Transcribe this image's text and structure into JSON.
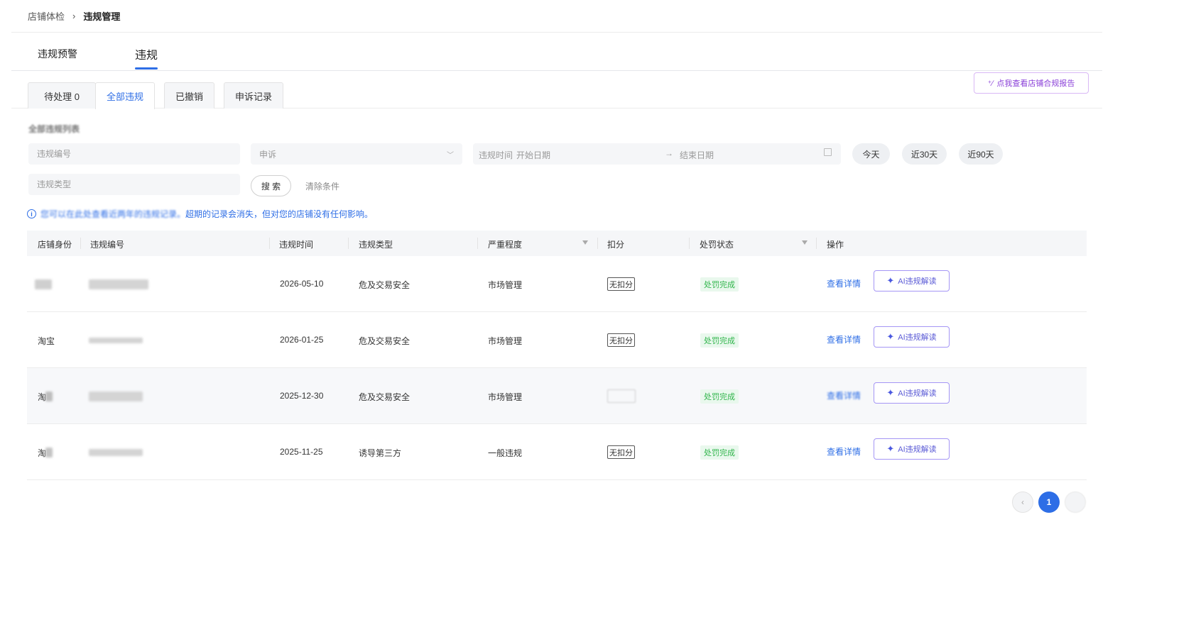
{
  "breadcrumb": {
    "parent": "店铺体检",
    "separator": "›",
    "current": "违规管理"
  },
  "main_tabs": [
    {
      "label": "违规预警",
      "active": false
    },
    {
      "label": "违规",
      "active": true
    }
  ],
  "sub_tabs": [
    {
      "label": "待处理 0",
      "active": false
    },
    {
      "label": "全部违规",
      "active": true
    },
    {
      "label": "已撤销",
      "active": false
    },
    {
      "label": "申诉记录",
      "active": false
    }
  ],
  "report_button": {
    "label": "点我查看店铺合规报告"
  },
  "section_title": "全部违规列表",
  "filters": {
    "violation_no_placeholder": "违规编号",
    "appeal_select_placeholder": "申诉",
    "violation_type_placeholder": "违规类型",
    "date_label": "违规时间",
    "start_date_placeholder": "开始日期",
    "range_arrow": "→",
    "end_date_placeholder": "结束日期",
    "quick": [
      "今天",
      "近30天",
      "近90天"
    ],
    "search_label": "搜 索",
    "clear_label": "清除条件"
  },
  "notice": {
    "text_blurred": "您可以在此处查看近两年的违规记录。",
    "text_visible": "超期的记录会消失，但对您的店铺没有任何影响。"
  },
  "table": {
    "headers": [
      "店铺身份",
      "违规编号",
      "违规时间",
      "违规类型",
      "严重程度",
      "扣分",
      "处罚状态",
      "操作"
    ],
    "rows": [
      {
        "shop": "",
        "date": "2026-05-10",
        "type": "危及交易安全",
        "severity": "市场管理",
        "score": "无扣分",
        "status": "处罚完成",
        "detail": "查看详情",
        "ai": "AI违规解读"
      },
      {
        "shop": "淘宝",
        "date": "2026-01-25",
        "type": "危及交易安全",
        "severity": "市场管理",
        "score": "无扣分",
        "status": "处罚完成",
        "detail": "查看详情",
        "ai": "AI违规解读"
      },
      {
        "shop": "淘",
        "date": "2025-12-30",
        "type": "危及交易安全",
        "severity": "市场管理",
        "score": "",
        "status": "处罚完成",
        "detail": "查看详情",
        "ai": "AI违规解读"
      },
      {
        "shop": "淘",
        "date": "2025-11-25",
        "type": "诱导第三方",
        "severity": "一般违规",
        "score": "无扣分",
        "status": "处罚完成",
        "detail": "查看详情",
        "ai": "AI违规解读"
      }
    ]
  },
  "pagination": {
    "prev": "‹",
    "current": "1"
  },
  "colors": {
    "primary": "#2e6ee6",
    "ai_purple": "#8a3fd8",
    "success": "#2fb54a"
  }
}
